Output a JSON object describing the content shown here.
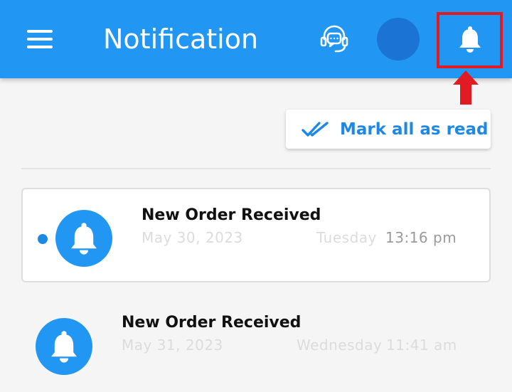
{
  "app_bar": {
    "title": "Notification",
    "background": "#2196f3",
    "icons": [
      "menu-icon",
      "support-headset-icon",
      "avatar",
      "bell-icon"
    ],
    "highlight_color": "#e01b24"
  },
  "toolbar": {
    "mark_all_read_label": "Mark all as read",
    "icon": "double-check-icon"
  },
  "notifications": [
    {
      "title": "New Order Received",
      "date": "May 30, 2023",
      "day": "Tuesday",
      "time": "13:16 pm",
      "unread": true
    },
    {
      "title": "New Order Received",
      "date": "May 31, 2023",
      "day": "Wednesday",
      "time": "11:41 am",
      "unread": false
    }
  ]
}
